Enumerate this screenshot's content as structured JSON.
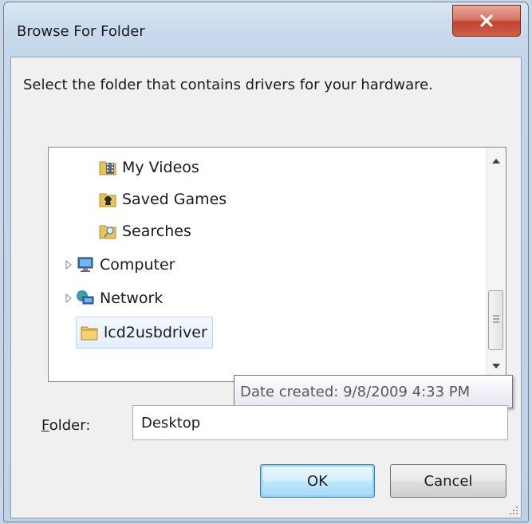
{
  "window": {
    "title": "Browse For Folder"
  },
  "instruction": "Select the folder that contains drivers for your hardware.",
  "tree": {
    "items": [
      {
        "label": "My Videos",
        "icon": "video-folder-icon",
        "expandable": false,
        "selected": false
      },
      {
        "label": "Saved Games",
        "icon": "saved-games-folder-icon",
        "expandable": false,
        "selected": false
      },
      {
        "label": "Searches",
        "icon": "searches-folder-icon",
        "expandable": false,
        "selected": false
      },
      {
        "label": "Computer",
        "icon": "computer-icon",
        "expandable": true,
        "selected": false
      },
      {
        "label": "Network",
        "icon": "network-icon",
        "expandable": true,
        "selected": false
      },
      {
        "label": "lcd2usbdriver",
        "icon": "folder-icon",
        "expandable": false,
        "selected": true
      }
    ]
  },
  "tooltip": "Date created: 9/8/2009 4:33 PM",
  "folder": {
    "label_prefix": "",
    "label_mnemonic": "F",
    "label_rest": "older:",
    "value": "Desktop"
  },
  "buttons": {
    "ok": "OK",
    "cancel": "Cancel"
  },
  "colors": {
    "accent": "#3c7fb1",
    "close": "#c2432f",
    "selection": "#b8d6fb"
  }
}
